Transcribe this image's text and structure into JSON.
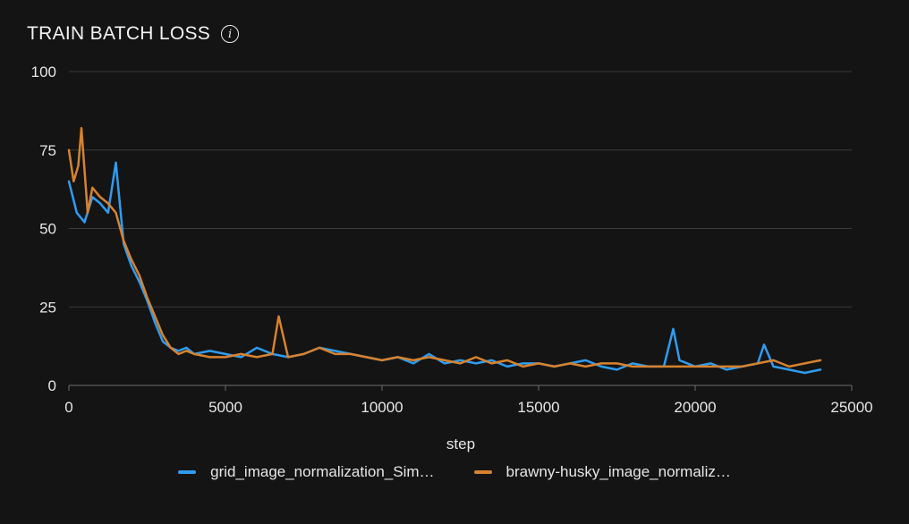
{
  "chart_data": {
    "type": "line",
    "title": "TRAIN BATCH LOSS",
    "info_icon": "info-icon",
    "xlabel": "step",
    "ylabel": "",
    "xlim": [
      0,
      25000
    ],
    "ylim": [
      0,
      100
    ],
    "xticks": [
      "0",
      "5000",
      "10000",
      "15000",
      "20000",
      "25000"
    ],
    "yticks": [
      "0",
      "25",
      "50",
      "75",
      "100"
    ],
    "grid": true,
    "legend_position": "bottom",
    "series": [
      {
        "name": "grid_image_normalization_Sim…",
        "color": "#2f9cf0",
        "x": [
          0,
          250,
          500,
          750,
          1000,
          1250,
          1500,
          1750,
          2000,
          2250,
          2500,
          2750,
          3000,
          3250,
          3500,
          3750,
          4000,
          4500,
          5000,
          5500,
          6000,
          6500,
          7000,
          7500,
          8000,
          8500,
          9000,
          9500,
          10000,
          10500,
          11000,
          11500,
          12000,
          12500,
          13000,
          13500,
          14000,
          14500,
          15000,
          15500,
          16000,
          16500,
          17000,
          17500,
          18000,
          18500,
          19000,
          19300,
          19500,
          20000,
          20500,
          21000,
          21500,
          22000,
          22200,
          22500,
          23000,
          23500,
          24000
        ],
        "y": [
          65,
          55,
          52,
          60,
          58,
          55,
          71,
          45,
          38,
          33,
          27,
          20,
          14,
          12,
          11,
          12,
          10,
          11,
          10,
          9,
          12,
          10,
          9,
          10,
          12,
          11,
          10,
          9,
          8,
          9,
          7,
          10,
          7,
          8,
          7,
          8,
          6,
          7,
          7,
          6,
          7,
          8,
          6,
          5,
          7,
          6,
          6,
          18,
          8,
          6,
          7,
          5,
          6,
          7,
          13,
          6,
          5,
          4,
          5
        ]
      },
      {
        "name": "brawny-husky_image_normaliz…",
        "color": "#d7822f",
        "x": [
          0,
          150,
          300,
          400,
          600,
          750,
          1000,
          1250,
          1500,
          1750,
          2000,
          2250,
          2500,
          2750,
          3000,
          3250,
          3500,
          3750,
          4000,
          4500,
          5000,
          5500,
          6000,
          6500,
          6700,
          7000,
          7500,
          8000,
          8500,
          9000,
          9500,
          10000,
          10500,
          11000,
          11500,
          12000,
          12500,
          13000,
          13500,
          14000,
          14500,
          15000,
          15500,
          16000,
          16500,
          17000,
          17500,
          18000,
          18500,
          19000,
          19500,
          20000,
          20500,
          21000,
          21500,
          22000,
          22500,
          23000,
          23500,
          24000
        ],
        "y": [
          75,
          65,
          70,
          82,
          55,
          63,
          60,
          58,
          55,
          46,
          40,
          35,
          28,
          22,
          16,
          12,
          10,
          11,
          10,
          9,
          9,
          10,
          9,
          10,
          22,
          9,
          10,
          12,
          10,
          10,
          9,
          8,
          9,
          8,
          9,
          8,
          7,
          9,
          7,
          8,
          6,
          7,
          6,
          7,
          6,
          7,
          7,
          6,
          6,
          6,
          6,
          6,
          6,
          6,
          6,
          7,
          8,
          6,
          7,
          8
        ]
      }
    ]
  }
}
